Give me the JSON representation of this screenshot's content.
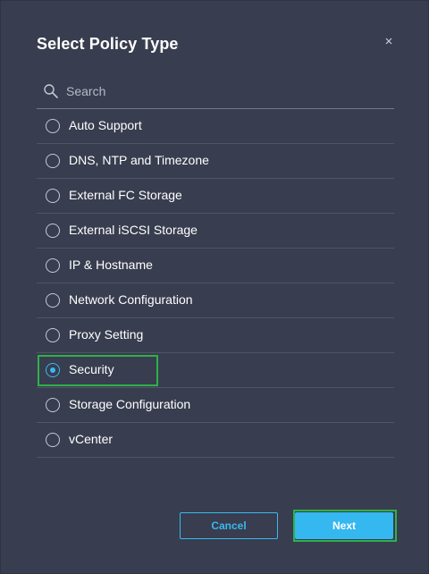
{
  "dialog": {
    "title": "Select Policy Type",
    "close_icon": "close-icon"
  },
  "search": {
    "icon": "search-icon",
    "placeholder": "Search",
    "value": ""
  },
  "policy_types": [
    {
      "label": "Auto Support",
      "selected": false
    },
    {
      "label": "DNS, NTP and Timezone",
      "selected": false
    },
    {
      "label": "External FC Storage",
      "selected": false
    },
    {
      "label": "External iSCSI Storage",
      "selected": false
    },
    {
      "label": "IP & Hostname",
      "selected": false
    },
    {
      "label": "Network Configuration",
      "selected": false
    },
    {
      "label": "Proxy Setting",
      "selected": false
    },
    {
      "label": "Security",
      "selected": true
    },
    {
      "label": "Storage Configuration",
      "selected": false
    },
    {
      "label": "vCenter",
      "selected": false
    }
  ],
  "footer": {
    "cancel_label": "Cancel",
    "next_label": "Next"
  },
  "colors": {
    "background": "#383d4f",
    "accent": "#3ab8ef",
    "highlight": "#2db14a",
    "text": "#ffffff"
  }
}
